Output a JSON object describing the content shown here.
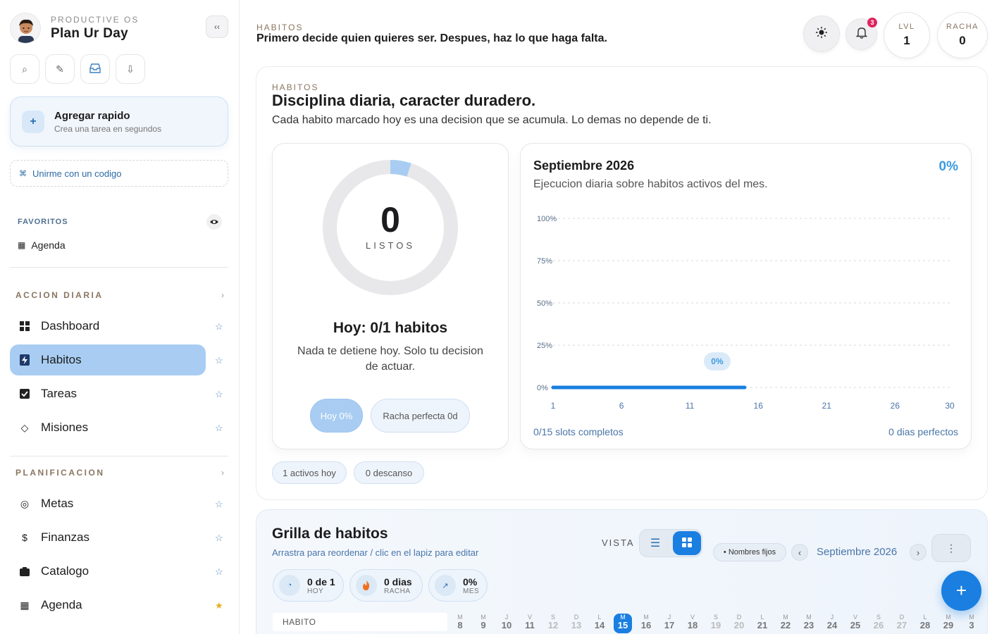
{
  "brand": {
    "kicker": "PRODUCTIVE OS",
    "title": "Plan Ur Day"
  },
  "sidebar": {
    "collapse_label": "‹‹",
    "quick_add": {
      "title": "Agregar rapido",
      "subtitle": "Crea una tarea en segundos"
    },
    "join_code": "Unirme con un codigo",
    "favorites": {
      "label": "FAVORITOS",
      "items": [
        "Agenda"
      ]
    },
    "sections": [
      {
        "label": "ACCION DIARIA",
        "items": [
          "Dashboard",
          "Habitos",
          "Tareas",
          "Misiones"
        ]
      },
      {
        "label": "PLANIFICACION",
        "items": [
          "Metas",
          "Finanzas",
          "Catalogo",
          "Agenda"
        ]
      }
    ]
  },
  "header": {
    "kicker": "HABITOS",
    "title": "Primero decide quien quieres ser. Despues, haz lo que haga falta.",
    "notif_count": "3",
    "level": {
      "label": "LVL",
      "value": "1"
    },
    "streak": {
      "label": "RACHA",
      "value": "0"
    }
  },
  "habits": {
    "kicker": "HABITOS",
    "title": "Disciplina diaria, caracter duradero.",
    "subtitle": "Cada habito marcado hoy es una decision que se acumula. Lo demas no depende de ti.",
    "ring": {
      "value": "0",
      "label": "LISTOS",
      "fill_fraction": 0.05
    },
    "today_title": "Hoy: 0/1 habitos",
    "today_sub": "Nada te detiene hoy. Solo tu decision de actuar.",
    "pill_today": "Hoy 0%",
    "pill_streak": "Racha perfecta 0d",
    "chip_active": "1 activos hoy",
    "chip_rest": "0 descanso"
  },
  "chart_data": {
    "type": "line",
    "title": "Septiembre 2026",
    "subtitle": "Ejecucion diaria sobre habitos activos del mes.",
    "summary_value": "0%",
    "x_ticks": [
      "1",
      "6",
      "11",
      "16",
      "21",
      "26",
      "30"
    ],
    "y_ticks": [
      "100%",
      "75%",
      "50%",
      "25%",
      "0%"
    ],
    "xlim": [
      1,
      30
    ],
    "ylim": [
      0,
      100
    ],
    "series": [
      {
        "x": [
          1,
          2,
          3,
          4,
          5,
          6,
          7,
          8,
          9,
          10,
          11,
          12,
          13,
          14,
          15
        ],
        "values": [
          0,
          0,
          0,
          0,
          0,
          0,
          0,
          0,
          0,
          0,
          0,
          0,
          0,
          0,
          0
        ]
      }
    ],
    "annotation": {
      "x": 13,
      "label": "0%"
    },
    "footer_left": "0/15 slots completos",
    "footer_right": "0 dias perfectos",
    "grid": true,
    "color": "#1a7fe0"
  },
  "grid": {
    "title": "Grilla de habitos",
    "subtitle": "Arrastra para reordenar / clic en el lapiz para editar",
    "vista_label": "VISTA",
    "names_chip": "• Nombres fijos",
    "month": "Septiembre 2026",
    "stats": [
      {
        "value": "0 de 1",
        "label": "HOY",
        "icon": "pie-icon"
      },
      {
        "value": "0 dias",
        "label": "RACHA",
        "icon": "flame-icon"
      },
      {
        "value": "0%",
        "label": "MES",
        "icon": "trend-icon"
      }
    ],
    "habit_col_label": "HABITO",
    "days": [
      {
        "l": "M",
        "n": "8"
      },
      {
        "l": "M",
        "n": "9"
      },
      {
        "l": "J",
        "n": "10"
      },
      {
        "l": "V",
        "n": "11"
      },
      {
        "l": "S",
        "n": "12"
      },
      {
        "l": "D",
        "n": "13"
      },
      {
        "l": "L",
        "n": "14"
      },
      {
        "l": "M",
        "n": "15"
      },
      {
        "l": "M",
        "n": "16"
      },
      {
        "l": "J",
        "n": "17"
      },
      {
        "l": "V",
        "n": "18"
      },
      {
        "l": "S",
        "n": "19"
      },
      {
        "l": "D",
        "n": "20"
      },
      {
        "l": "L",
        "n": "21"
      },
      {
        "l": "M",
        "n": "22"
      },
      {
        "l": "M",
        "n": "23"
      },
      {
        "l": "J",
        "n": "24"
      },
      {
        "l": "V",
        "n": "25"
      },
      {
        "l": "S",
        "n": "26"
      },
      {
        "l": "D",
        "n": "27"
      },
      {
        "l": "L",
        "n": "28"
      },
      {
        "l": "M",
        "n": "29"
      },
      {
        "l": "M",
        "n": "3"
      }
    ],
    "today_index": 7
  },
  "colors": {
    "accent": "#1a7fe0",
    "active_nav": "#a9cdf2",
    "badge": "#e0245e",
    "fav_star": "#e8b020"
  }
}
